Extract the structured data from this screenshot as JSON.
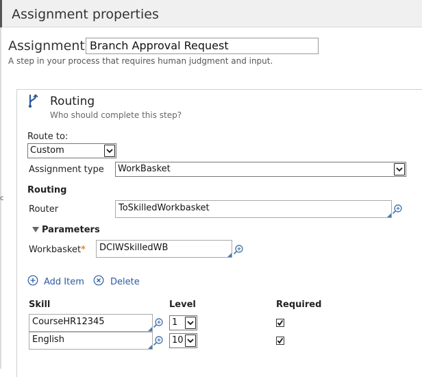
{
  "window": {
    "title": "Assignment properties"
  },
  "assignment": {
    "label": "Assignment:",
    "name": "Branch Approval Request",
    "description": "A step in your process that requires human judgment and input."
  },
  "routing": {
    "title": "Routing",
    "subtitle": "Who should complete this step?",
    "route_to_label": "Route to:",
    "route_to_value": "Custom",
    "assignment_type_label": "Assignment type",
    "assignment_type_value": "WorkBasket",
    "section_label": "Routing",
    "router_label": "Router",
    "router_value": "ToSkilledWorkbasket",
    "parameters_label": "Parameters",
    "workbasket_label": "Workbasket",
    "workbasket_required_mark": "*",
    "workbasket_value": "DCIWSkilledWB",
    "add_item_label": "Add Item",
    "delete_label": "Delete"
  },
  "skills_table": {
    "headers": {
      "skill": "Skill",
      "level": "Level",
      "required": "Required"
    },
    "rows": [
      {
        "skill": "CourseHR12345",
        "level": "1",
        "required": true
      },
      {
        "skill": "English",
        "level": "10",
        "required": true
      }
    ]
  },
  "edge": {
    "fragment": "c"
  },
  "icons": {
    "routing": "branch-icon",
    "lookup": "magnifier-plus-icon",
    "add": "plus-circle-icon",
    "delete": "x-circle-icon",
    "expand": "triangle-down-icon",
    "check": "checkmark-icon"
  },
  "colors": {
    "accent": "#2a5aa0",
    "required_star": "#e08a1e",
    "titlebar_bg": "#f0f0f0"
  }
}
